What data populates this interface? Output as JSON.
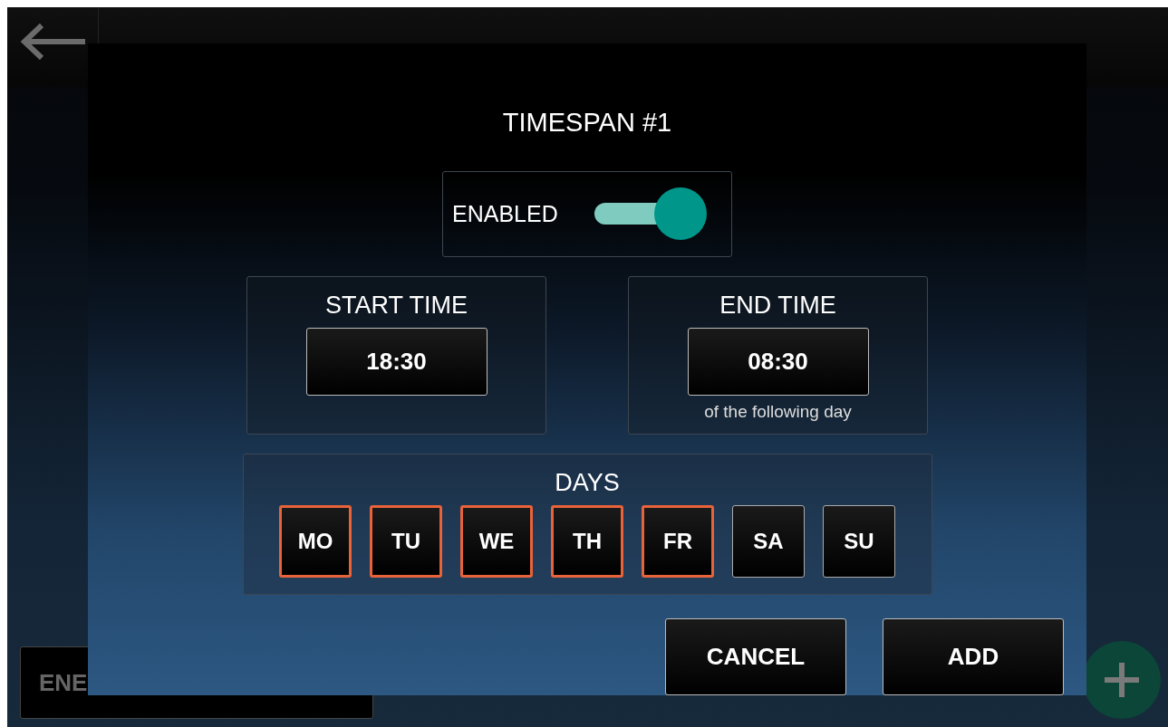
{
  "background_button": {
    "label": "ENE"
  },
  "dialog": {
    "title": "TIMESPAN #1",
    "enabled": {
      "label": "ENABLED",
      "on": true
    },
    "start": {
      "label": "START TIME",
      "value": "18:30"
    },
    "end": {
      "label": "END TIME",
      "value": "08:30",
      "note": "of the following day"
    },
    "days": {
      "label": "DAYS",
      "items": [
        {
          "label": "MO",
          "selected": true
        },
        {
          "label": "TU",
          "selected": true
        },
        {
          "label": "WE",
          "selected": true
        },
        {
          "label": "TH",
          "selected": true
        },
        {
          "label": "FR",
          "selected": true
        },
        {
          "label": "SA",
          "selected": false
        },
        {
          "label": "SU",
          "selected": false
        }
      ]
    },
    "buttons": [
      "CANCEL",
      "ADD"
    ]
  }
}
